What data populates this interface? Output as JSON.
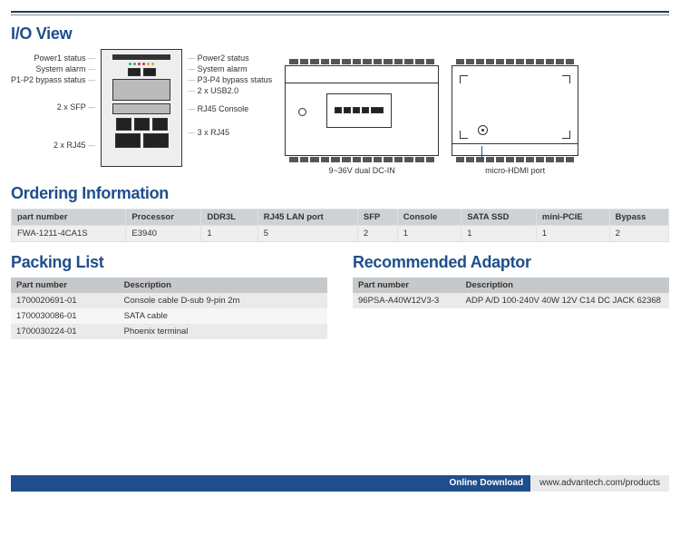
{
  "sections": {
    "io_view": "I/O View",
    "ordering": "Ordering Information",
    "packing": "Packing List",
    "adaptor": "Recommended Adaptor"
  },
  "io_labels": {
    "left": {
      "power1": "Power1 status",
      "sys_alarm": "System alarm",
      "p1p2_bypass": "P1-P2 bypass status",
      "sfp2": "2 x SFP",
      "rj45_2": "2 x RJ45"
    },
    "right": {
      "power2": "Power2 status",
      "sys_alarm": "System alarm",
      "p3p4_bypass": "P3-P4 bypass status",
      "usb2": "2 x USB2.0",
      "rj45_console": "RJ45 Console",
      "rj45_3": "3 x RJ45"
    },
    "top_caption": "9~36V dual DC-IN",
    "side_caption": "micro-HDMI port"
  },
  "chart_data": {
    "type": "table",
    "title": "Ordering Information",
    "columns": [
      "part number",
      "Processor",
      "DDR3L",
      "RJ45 LAN port",
      "SFP",
      "Console",
      "SATA SSD",
      "mini-PCIE",
      "Bypass"
    ],
    "rows": [
      [
        "FWA-1211-4CA1S",
        "E3940",
        "1",
        "5",
        "2",
        "1",
        "1",
        "1",
        "2"
      ]
    ]
  },
  "packing": {
    "headers": {
      "pn": "Part number",
      "desc": "Description"
    },
    "rows": [
      {
        "pn": "1700020691-01",
        "desc": "Console cable D-sub 9-pin 2m"
      },
      {
        "pn": "1700030086-01",
        "desc": "SATA cable"
      },
      {
        "pn": "1700030224-01",
        "desc": "Phoenix terminal"
      }
    ]
  },
  "adaptor": {
    "headers": {
      "pn": "Part number",
      "desc": "Description"
    },
    "rows": [
      {
        "pn": "96PSA-A40W12V3-3",
        "desc": "ADP A/D 100-240V 40W 12V C14 DC JACK 62368"
      }
    ]
  },
  "footer": {
    "label": "Online Download",
    "url": "www.advantech.com/products"
  }
}
